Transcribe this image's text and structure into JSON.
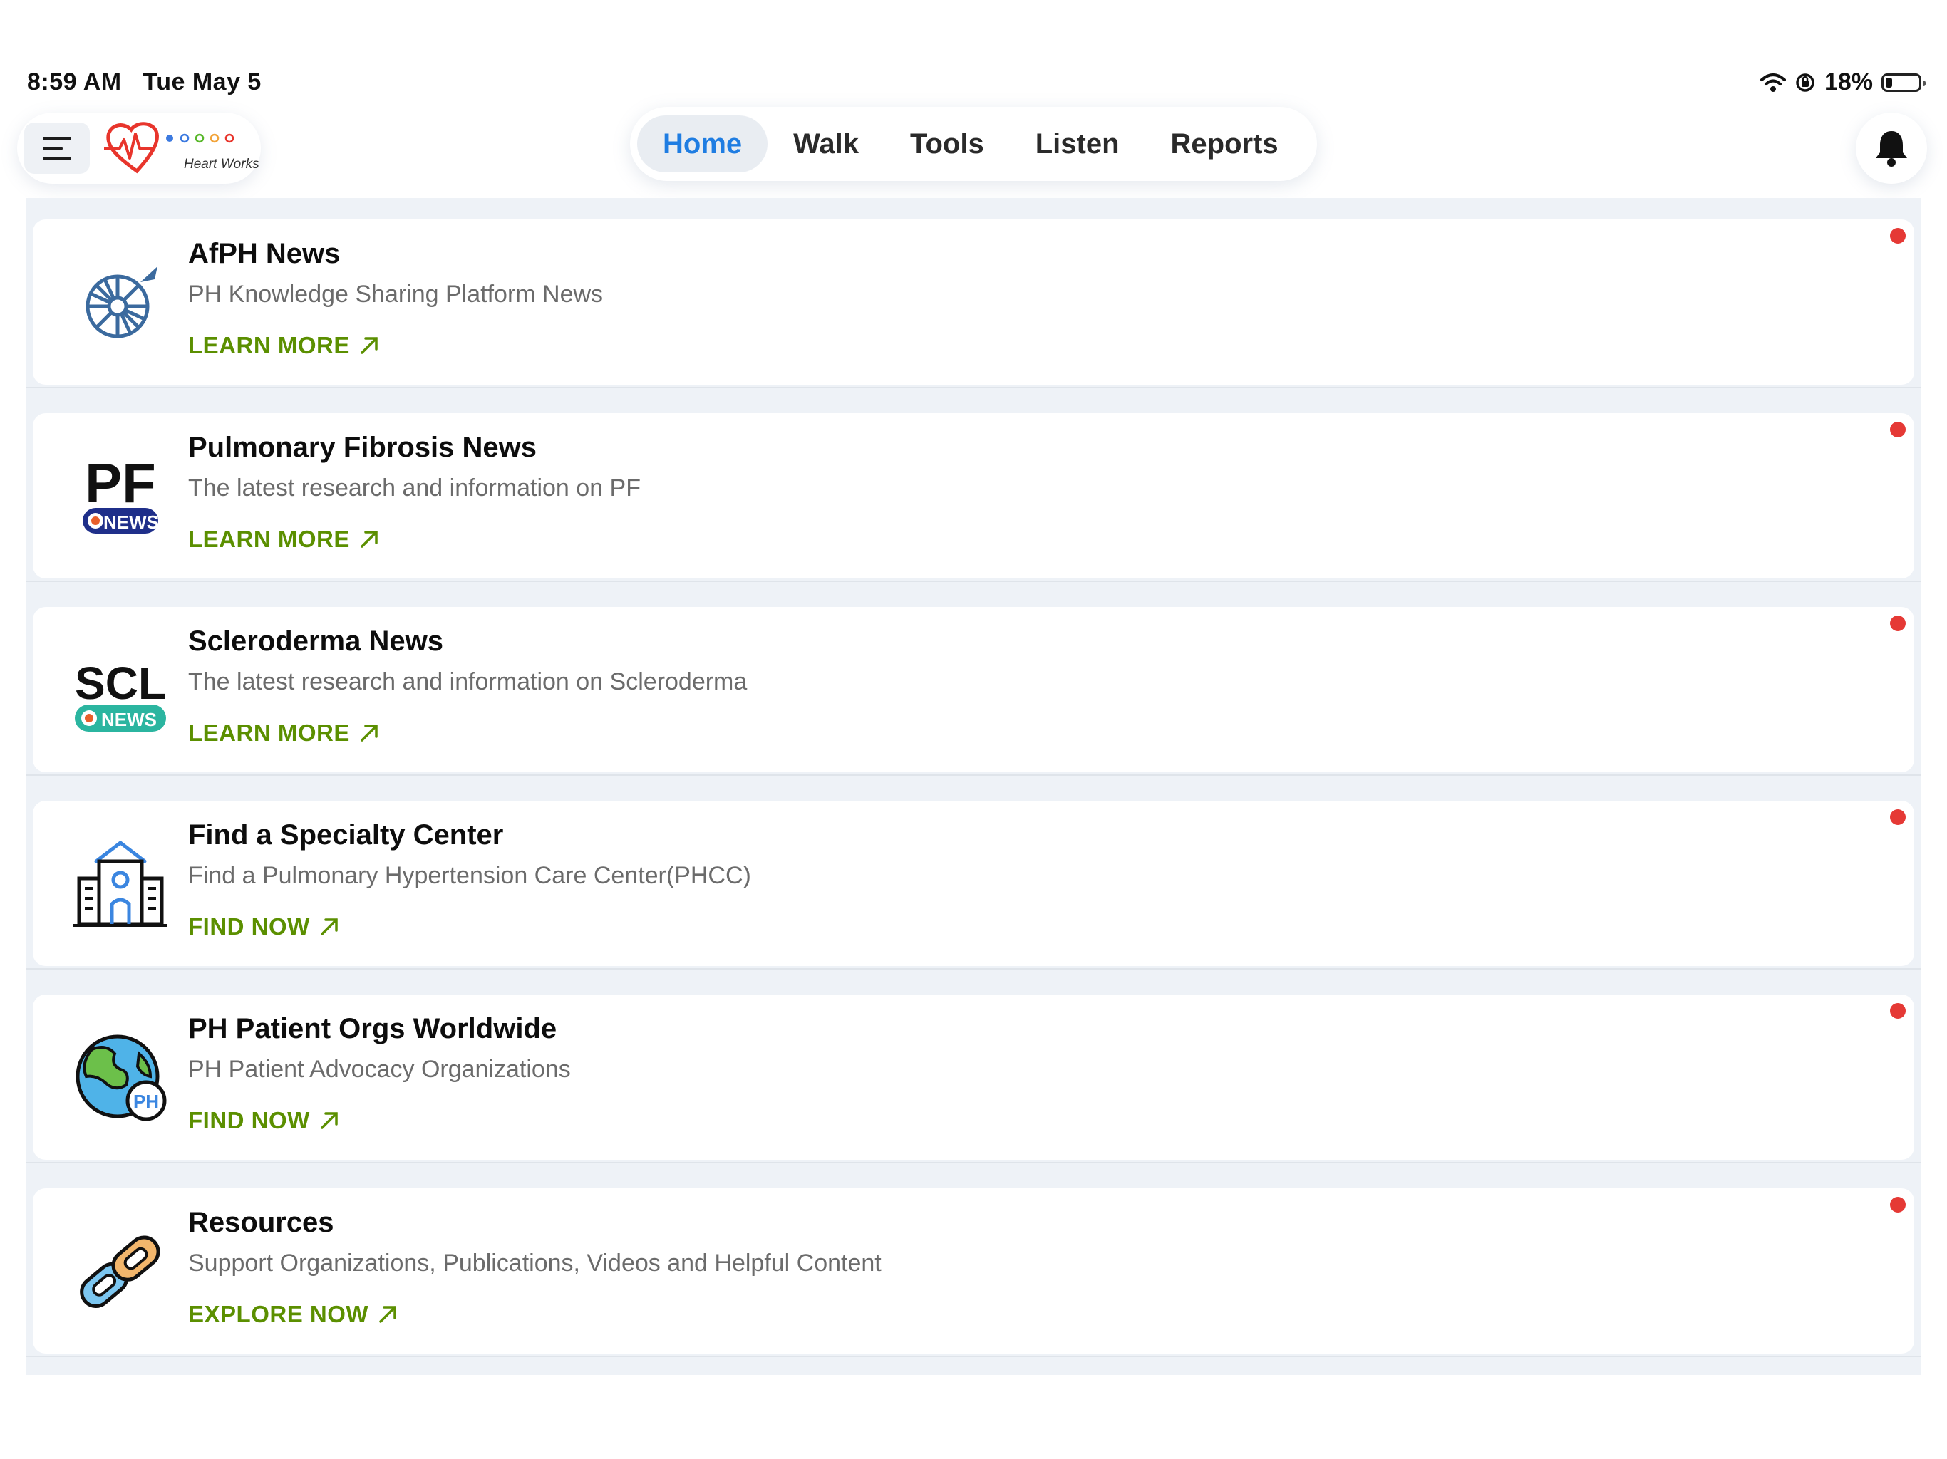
{
  "status_bar": {
    "time": "8:59 AM",
    "date": "Tue May 5",
    "battery": "18%",
    "battery_level": 0.18
  },
  "header": {
    "brand_name": "Heart Works",
    "tabs": [
      {
        "label": "Home",
        "active": true
      },
      {
        "label": "Walk",
        "active": false
      },
      {
        "label": "Tools",
        "active": false
      },
      {
        "label": "Listen",
        "active": false
      },
      {
        "label": "Reports",
        "active": false
      }
    ]
  },
  "colors": {
    "accent": "#1f7de2",
    "link": "#5b8f00",
    "unread_dot": "#e53935"
  },
  "cards": [
    {
      "title": "AfPH News",
      "subtitle": "PH Knowledge Sharing Platform News",
      "link": "LEARN MORE",
      "icon": "afph-logo-icon"
    },
    {
      "title": "Pulmonary Fibrosis News",
      "subtitle": "The latest research and information on PF",
      "link": "LEARN MORE",
      "icon": "pf-news-logo-icon",
      "logo_text": "PF",
      "logo_badge": "NEWS"
    },
    {
      "title": "Scleroderma News",
      "subtitle": "The latest research and information on Scleroderma",
      "link": "LEARN MORE",
      "icon": "scl-news-logo-icon",
      "logo_text": "SCL",
      "logo_badge": "NEWS"
    },
    {
      "title": "Find a Specialty Center",
      "subtitle": "Find a Pulmonary Hypertension Care Center(PHCC)",
      "link": "FIND NOW",
      "icon": "hospital-building-icon"
    },
    {
      "title": "PH Patient Orgs Worldwide",
      "subtitle": "PH Patient Advocacy Organizations",
      "link": "FIND NOW",
      "icon": "globe-icon",
      "logo_badge": "PH"
    },
    {
      "title": "Resources",
      "subtitle": "Support Organizations, Publications, Videos and Helpful Content",
      "link": "EXPLORE NOW",
      "icon": "chain-link-icon"
    }
  ]
}
